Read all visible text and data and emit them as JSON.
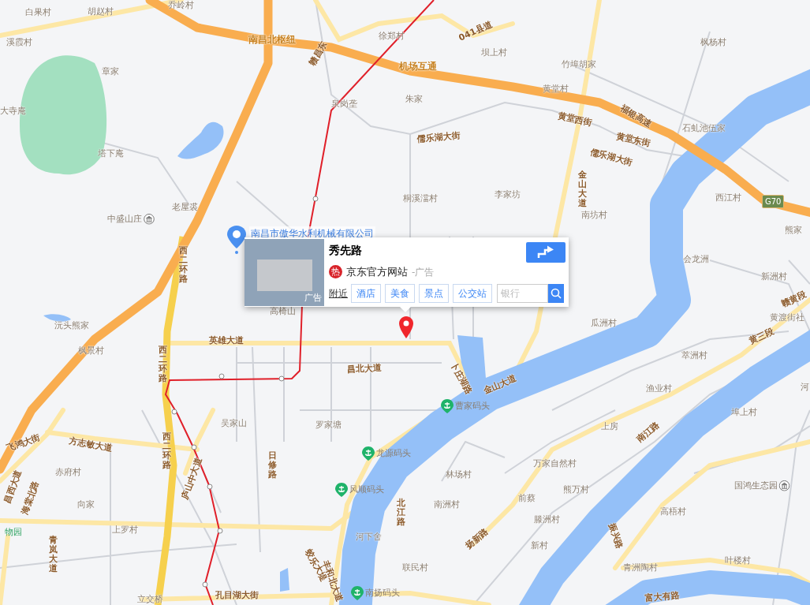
{
  "map_labels": [
    {
      "kind": "village",
      "text": "白果村"
    },
    {
      "kind": "village",
      "text": "胡赵村"
    },
    {
      "kind": "village",
      "text": "乔岭村"
    },
    {
      "kind": "village",
      "text": "溪霞村"
    },
    {
      "kind": "village",
      "text": "章家"
    },
    {
      "kind": "village",
      "text": "大寺庵"
    },
    {
      "kind": "village",
      "text": "塔下庵"
    },
    {
      "kind": "village",
      "text": "老屋裘"
    },
    {
      "kind": "poi",
      "text": "中盛山庄"
    },
    {
      "kind": "highway",
      "text": "南昌北枢纽"
    },
    {
      "kind": "road",
      "text": "赣昌东"
    },
    {
      "kind": "village",
      "text": "徐郑村"
    },
    {
      "kind": "road",
      "text": "041县道"
    },
    {
      "kind": "highway",
      "text": "机场互通"
    },
    {
      "kind": "village",
      "text": "泉岗垄"
    },
    {
      "kind": "village",
      "text": "朱家"
    },
    {
      "kind": "village",
      "text": "坝上村"
    },
    {
      "kind": "village",
      "text": "竹埠胡家"
    },
    {
      "kind": "village",
      "text": "黄堂村"
    },
    {
      "kind": "village",
      "text": "枫杨村"
    },
    {
      "kind": "road",
      "text": "黄堂西街"
    },
    {
      "kind": "road",
      "text": "福银高速"
    },
    {
      "kind": "road",
      "text": "黄堂东街"
    },
    {
      "kind": "road",
      "text": "儒乐湖大街"
    },
    {
      "kind": "road",
      "text": "儒乐湖大街"
    },
    {
      "kind": "village",
      "text": "石虬池伍家"
    },
    {
      "kind": "road",
      "text": "金山大道"
    },
    {
      "kind": "village",
      "text": "李家坊"
    },
    {
      "kind": "village",
      "text": "桐溪澢村"
    },
    {
      "kind": "village",
      "text": "南坊村"
    },
    {
      "kind": "village",
      "text": "西江村"
    },
    {
      "kind": "village",
      "text": "熊家"
    },
    {
      "kind": "village",
      "text": "会龙洲"
    },
    {
      "kind": "village",
      "text": "新洲村"
    },
    {
      "kind": "road",
      "text": "赣黄段"
    },
    {
      "kind": "village",
      "text": "黄渡街社"
    },
    {
      "kind": "road",
      "text": "黄三段"
    },
    {
      "kind": "village",
      "text": "瓜洲村"
    },
    {
      "kind": "village",
      "text": "萃洲村"
    },
    {
      "kind": "village",
      "text": "渔业村"
    },
    {
      "kind": "village",
      "text": "河"
    },
    {
      "kind": "village",
      "text": "埠上村"
    },
    {
      "kind": "road",
      "text": "西二环路"
    },
    {
      "kind": "road",
      "text": "西二环路"
    },
    {
      "kind": "village",
      "text": "沅头熊家"
    },
    {
      "kind": "village",
      "text": "枫景村"
    },
    {
      "kind": "village",
      "text": "高椅山"
    },
    {
      "kind": "road",
      "text": "英雄大道"
    },
    {
      "kind": "road",
      "text": "昌北大道"
    },
    {
      "kind": "road",
      "text": "卜庄湖路"
    },
    {
      "kind": "road",
      "text": "金山大道"
    },
    {
      "kind": "pier",
      "text": "曹家码头"
    },
    {
      "kind": "village",
      "text": "吴家山"
    },
    {
      "kind": "village",
      "text": "罗家塘"
    },
    {
      "kind": "road",
      "text": "飞鸿大街"
    },
    {
      "kind": "road",
      "text": "方志敏大道"
    },
    {
      "kind": "road",
      "text": "西二环路"
    },
    {
      "kind": "road",
      "text": "庐山中大道"
    },
    {
      "kind": "road",
      "text": "日修路"
    },
    {
      "kind": "pier",
      "text": "龙源码头"
    },
    {
      "kind": "village",
      "text": "赤府村"
    },
    {
      "kind": "road",
      "text": "昌西大道"
    },
    {
      "kind": "road",
      "text": "海棠北路"
    },
    {
      "kind": "village",
      "text": "向家"
    },
    {
      "kind": "pier",
      "text": "风顺码头"
    },
    {
      "kind": "road",
      "text": "北江路"
    },
    {
      "kind": "village",
      "text": "上罗村"
    },
    {
      "kind": "park",
      "text": "物园"
    },
    {
      "kind": "village",
      "text": "河下舍"
    },
    {
      "kind": "road",
      "text": "青岚大道"
    },
    {
      "kind": "road",
      "text": "蛟乐大堤"
    },
    {
      "kind": "road",
      "text": "丰和北大道"
    },
    {
      "kind": "village",
      "text": "联民村"
    },
    {
      "kind": "pier",
      "text": "南扬码头"
    },
    {
      "kind": "road",
      "text": "孔目湖大街"
    },
    {
      "kind": "village",
      "text": "立交桥"
    },
    {
      "kind": "village",
      "text": "上房"
    },
    {
      "kind": "road",
      "text": "南江路"
    },
    {
      "kind": "village",
      "text": "万家自然村"
    },
    {
      "kind": "village",
      "text": "林场村"
    },
    {
      "kind": "village",
      "text": "熊万村"
    },
    {
      "kind": "village",
      "text": "前蔡"
    },
    {
      "kind": "village",
      "text": "南洲村"
    },
    {
      "kind": "village",
      "text": "滕洲村"
    },
    {
      "kind": "road",
      "text": "扬新路"
    },
    {
      "kind": "village",
      "text": "新村"
    },
    {
      "kind": "poi",
      "text": "国鸿生态园"
    },
    {
      "kind": "village",
      "text": "高梧村"
    },
    {
      "kind": "road",
      "text": "振兴路"
    },
    {
      "kind": "village",
      "text": "叶楼村"
    },
    {
      "kind": "village",
      "text": "青洲陶村"
    },
    {
      "kind": "road",
      "text": "富大有路"
    }
  ],
  "highway_shield": "G70",
  "company_pin": {
    "label": "南昌市傲华水利机械有限公司"
  },
  "popup": {
    "title": "秀先路",
    "photo_badge": "广告",
    "hot_badge": "热",
    "ad_link": "京东官方网站",
    "ad_note": "-广告",
    "nearby_label": "附近",
    "nearby_buttons": [
      "酒店",
      "美食",
      "景点",
      "公交站"
    ],
    "search": {
      "placeholder": "银行"
    }
  }
}
